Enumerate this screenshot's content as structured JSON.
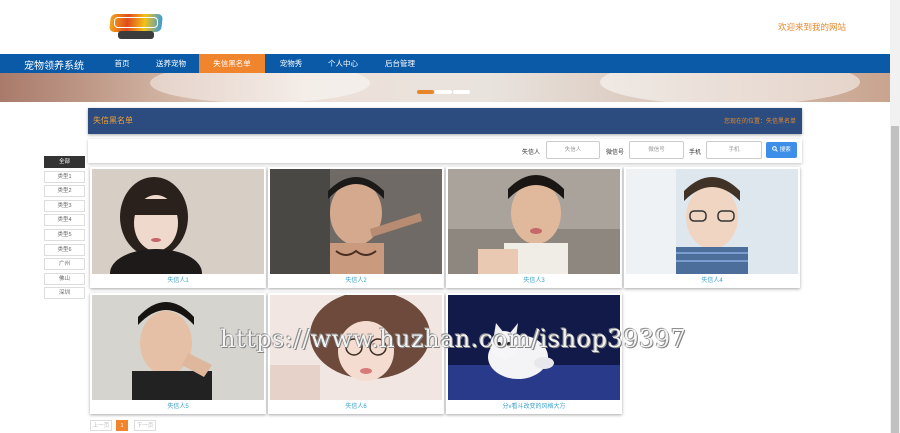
{
  "header": {
    "welcome": "欢迎来到我的网站"
  },
  "nav": {
    "brand": "宠物领养系统",
    "items": [
      {
        "label": "首页"
      },
      {
        "label": "送养宠物"
      },
      {
        "label": "失信黑名单"
      },
      {
        "label": "宠物秀"
      },
      {
        "label": "个人中心"
      },
      {
        "label": "后台管理"
      }
    ],
    "active_index": 2
  },
  "banner": {
    "slides": 3,
    "active_slide": 0
  },
  "sidebar": {
    "items": [
      {
        "label": "全部"
      },
      {
        "label": "类型1"
      },
      {
        "label": "类型2"
      },
      {
        "label": "类型3"
      },
      {
        "label": "类型4"
      },
      {
        "label": "类型5"
      },
      {
        "label": "类型6"
      },
      {
        "label": "广州"
      },
      {
        "label": "佛山"
      },
      {
        "label": "深圳"
      }
    ]
  },
  "panel": {
    "title": "失信黑名单",
    "breadcrumb": "您现在的位置：失信黑名单"
  },
  "search": {
    "name_label": "失信人",
    "name_placeholder": "失信人",
    "wechat_label": "微信号",
    "wechat_placeholder": "微信号",
    "phone_label": "手机",
    "phone_placeholder": "手机",
    "button_label": "搜索",
    "button_icon": "search-icon"
  },
  "cards": [
    {
      "caption": "失信人1"
    },
    {
      "caption": "失信人2"
    },
    {
      "caption": "失信人3"
    },
    {
      "caption": "失信人4"
    },
    {
      "caption": "失信人5"
    },
    {
      "caption": "失信人6"
    },
    {
      "caption": "分v看斗改变的风格大方"
    }
  ],
  "pagination": {
    "prev": "上一页",
    "current": "1",
    "next": "下一页"
  },
  "watermark": "https://www.huzhan.com/ishop39397",
  "colors": {
    "nav_bg": "#0a5aa8",
    "accent": "#f0852d",
    "panel_bg": "#2c4b7e",
    "caption": "#3aa0c8"
  }
}
